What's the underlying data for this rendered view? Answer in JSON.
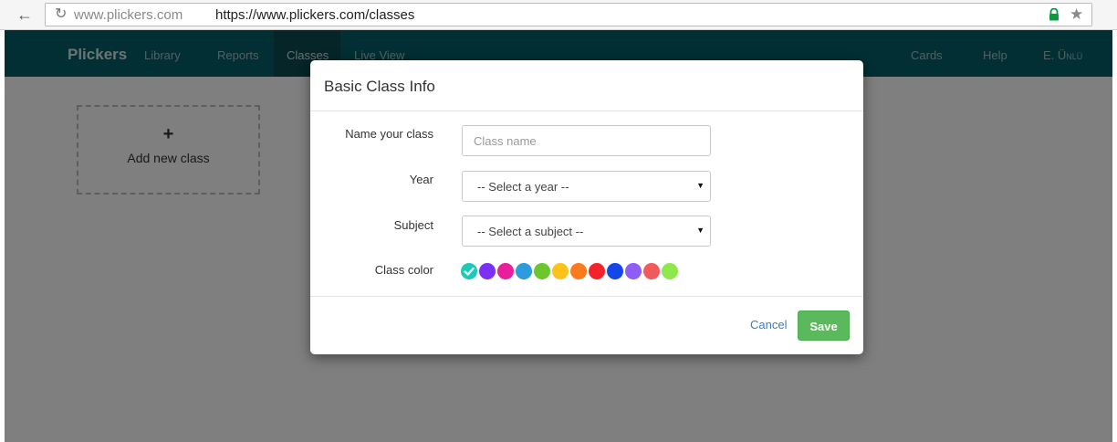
{
  "browser": {
    "url_domain": "www.plickers.com",
    "url_full": "https://www.plickers.com/classes",
    "back_icon": "arrow-left-icon",
    "reload_icon": "reload-icon",
    "lock_icon": "lock-icon",
    "star_icon": "star-icon"
  },
  "nav": {
    "logo": "Plickers",
    "links": [
      "Library",
      "Reports",
      "Classes",
      "Live View"
    ],
    "right_links": [
      "Cards",
      "Help",
      "E. Ünlü"
    ],
    "active": "Classes",
    "color": "#035f69"
  },
  "page": {
    "add_class_label": "Add new class",
    "plus_icon": "plus-icon"
  },
  "modal": {
    "title": "Basic Class Info",
    "name_label": "Name your class",
    "name_placeholder": "Class name",
    "year_label": "Year",
    "year_value": "-- Select a year --",
    "subject_label": "Subject",
    "subject_value": "-- Select a subject --",
    "color_label": "Class color",
    "colors": [
      "#1ec9b7",
      "#7b2ff7",
      "#e91e9c",
      "#2d9bde",
      "#6cc72e",
      "#ffc21a",
      "#ff7a1a",
      "#f5222d",
      "#1446e8",
      "#8f5cf7",
      "#f05a5a",
      "#8ee84a"
    ],
    "selected_color": "#1ec9b7",
    "cancel_label": "Cancel",
    "save_label": "Save",
    "save_color": "#5cb85c"
  }
}
